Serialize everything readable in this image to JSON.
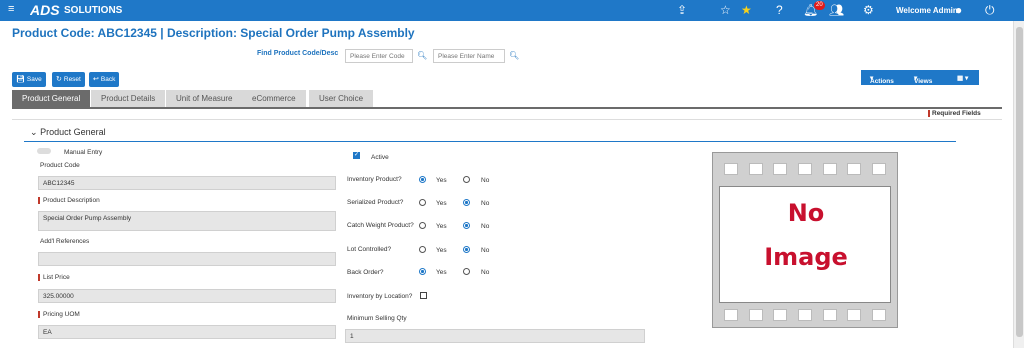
{
  "topbar": {
    "hamburger_icon": "menu-icon",
    "logo_text": "ADS SOLUTIONS",
    "notification_count": "20",
    "welcome": "Welcome Admin"
  },
  "page": {
    "title": "Product Code:  ABC12345 | Description: Special Order Pump Assembly",
    "find_label": "Find Product Code/Desc",
    "code_placeholder": "Please Enter Code",
    "name_placeholder": "Please Enter Name"
  },
  "toolbar": {
    "save": "Save",
    "reset": "Reset",
    "back": "Back",
    "actions": "Actions",
    "views": "Views"
  },
  "tabs": [
    {
      "label": "Product General",
      "active": true
    },
    {
      "label": "Product Details",
      "active": false
    },
    {
      "label": "Unit of Measure",
      "active": false
    },
    {
      "label": "eCommerce",
      "active": false
    },
    {
      "label": "User Choice",
      "active": false
    }
  ],
  "required_fields": "Required Fields",
  "section": {
    "title": "Product General",
    "manual_entry": "Manual Entry",
    "product_code_label": "Product Code",
    "product_code": "ABC12345",
    "product_desc_label": "Product Description",
    "product_desc": "Special Order Pump Assembly",
    "refs_label": "Add'l References",
    "refs": "",
    "list_price_label": "List Price",
    "list_price": "325.00000",
    "pricing_uom_label": "Pricing UOM",
    "pricing_uom": "EA"
  },
  "options": {
    "active_label": "Active",
    "active": true,
    "yes": "Yes",
    "no": "No",
    "inventory_product": {
      "label": "Inventory Product?",
      "value": "Yes"
    },
    "serialized_product": {
      "label": "Serialized Product?",
      "value": "No"
    },
    "catch_weight": {
      "label": "Catch Weight Product?",
      "value": "No"
    },
    "lot_controlled": {
      "label": "Lot Controlled?",
      "value": "No"
    },
    "back_order": {
      "label": "Back Order?",
      "value": "Yes"
    },
    "inventory_by_location": {
      "label": "Inventory by Location?",
      "checked": false
    },
    "min_selling_qty_label": "Minimum Selling Qty",
    "min_selling_qty": "1"
  },
  "image": {
    "line1": "No",
    "line2": "Image"
  },
  "colors": {
    "primary": "#1f78c8",
    "required": "#c0392b",
    "no_image": "#c8102e"
  }
}
